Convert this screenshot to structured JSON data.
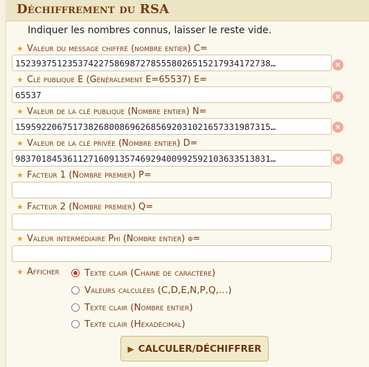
{
  "header": {
    "title": "Déchiffrement du RSA"
  },
  "intro": "Indiquer les nombres connus, laisser le reste vide.",
  "fields": [
    {
      "label": "Valeur du message chiffré (nombre entier) C=",
      "value": "1523937512353742275869872785558026515217934172738…",
      "clear": true
    },
    {
      "label": "Clé publique E (Généralement E=65537) E=",
      "value": "65537",
      "clear": true
    },
    {
      "label": "Valeur de la clé publique (Nombre entier) N=",
      "value": "1595922067517382680086962685692031021657331987315…",
      "clear": true
    },
    {
      "label": "Valeur de la clé privée (Nombre entier) D=",
      "value": "9837018453611271609135746929400992592103633513831…",
      "clear": true
    },
    {
      "label": "Facteur 1 (Nombre premier) P=",
      "value": "",
      "clear": false
    },
    {
      "label": "Facteur 2 (Nombre premier) Q=",
      "value": "",
      "clear": false
    },
    {
      "label": "Valeur intermédiaire Phi (Nombre entier) φ=",
      "value": "",
      "clear": false
    }
  ],
  "display": {
    "label": "Afficher",
    "options": [
      {
        "label": "Texte clair (Chaine de caractère)",
        "selected": true
      },
      {
        "label": "Valeurs calculées (C,D,E,N,P,Q,…)",
        "selected": false
      },
      {
        "label": "Texte clair (Nombre entier)",
        "selected": false
      },
      {
        "label": "Texte clair (Hexadécimal)",
        "selected": false
      }
    ]
  },
  "submit_label": "Calculer/Déchiffrer",
  "icons": {
    "required": "star-icon",
    "clear": "clear-x-icon",
    "submit": "play-triangle-icon"
  },
  "colors": {
    "label": "#7a3a12",
    "star": "#e0a11c",
    "clear": "#eeaaa0",
    "radio_selected": "#c0392b"
  }
}
